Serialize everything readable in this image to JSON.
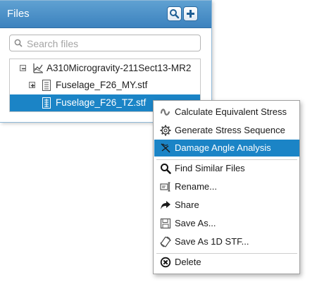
{
  "panel": {
    "title": "Files",
    "search_placeholder": "Search files"
  },
  "tree": {
    "items": [
      {
        "label": "A310Microgravity-211Sect13-MR2",
        "icon": "chart-icon",
        "expander": "collapse"
      },
      {
        "label": "Fuselage_F26_MY.stf",
        "icon": "document-icon",
        "expander": "expand"
      },
      {
        "label": "Fuselage_F26_TZ.stf",
        "icon": "table-document-icon",
        "selected": true
      }
    ]
  },
  "context_menu": {
    "items": [
      {
        "label": "Calculate Equivalent Stress",
        "icon": "wave-icon"
      },
      {
        "label": "Generate Stress Sequence",
        "icon": "gear-icon"
      },
      {
        "label": "Damage Angle Analysis",
        "icon": "angle-icon",
        "highlighted": true
      },
      {
        "label": "Find Similar Files",
        "icon": "search-icon"
      },
      {
        "label": "Rename...",
        "icon": "rename-icon"
      },
      {
        "label": "Share",
        "icon": "share-arrow-icon"
      },
      {
        "label": "Save As...",
        "icon": "floppy-disk-icon"
      },
      {
        "label": "Save As 1D STF...",
        "icon": "rotate-icon"
      },
      {
        "label": "Delete",
        "icon": "delete-icon"
      }
    ]
  },
  "colors": {
    "header": "#4a8fc8",
    "selection": "#1b84c6"
  }
}
